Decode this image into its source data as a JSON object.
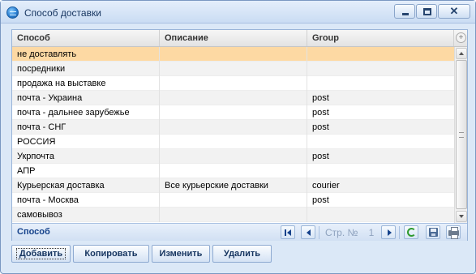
{
  "window": {
    "title": "Способ доставки",
    "close_symbol": "✕"
  },
  "grid": {
    "columns": [
      "Способ",
      "Описание",
      "Group"
    ],
    "header_plus_symbol": "+",
    "rows": [
      {
        "method": "не доставлять",
        "description": "",
        "group": ""
      },
      {
        "method": "посредники",
        "description": "",
        "group": ""
      },
      {
        "method": "продажа на выставке",
        "description": "",
        "group": ""
      },
      {
        "method": "почта - Украина",
        "description": "",
        "group": "post"
      },
      {
        "method": "почта - дальнее зарубежье",
        "description": "",
        "group": "post"
      },
      {
        "method": "почта - СНГ",
        "description": "",
        "group": "post"
      },
      {
        "method": "РОССИЯ",
        "description": "",
        "group": ""
      },
      {
        "method": "Укрпочта",
        "description": "",
        "group": "post"
      },
      {
        "method": "АПР",
        "description": "",
        "group": ""
      },
      {
        "method": "Курьерская доставка",
        "description": "Все курьерские доставки",
        "group": "courier"
      },
      {
        "method": "почта - Москва",
        "description": "",
        "group": "post"
      },
      {
        "method": "самовывоз",
        "description": "",
        "group": ""
      }
    ],
    "selected_row": 0
  },
  "footer": {
    "group_label": "Способ",
    "page_label": "Стр. №",
    "page_number": "1"
  },
  "actions": {
    "add": "Добавить",
    "copy": "Копировать",
    "edit": "Изменить",
    "delete": "Удалить"
  },
  "colors": {
    "selected_row": "#fdd9a3",
    "window_bg": "#dbe8f7",
    "accent": "#15428b"
  },
  "icons": {
    "app": "globe-icon",
    "first_page": "first-page-icon",
    "prev_page": "prev-page-icon",
    "next_page": "next-page-icon",
    "refresh": "refresh-icon",
    "save": "save-icon",
    "print": "print-icon"
  }
}
